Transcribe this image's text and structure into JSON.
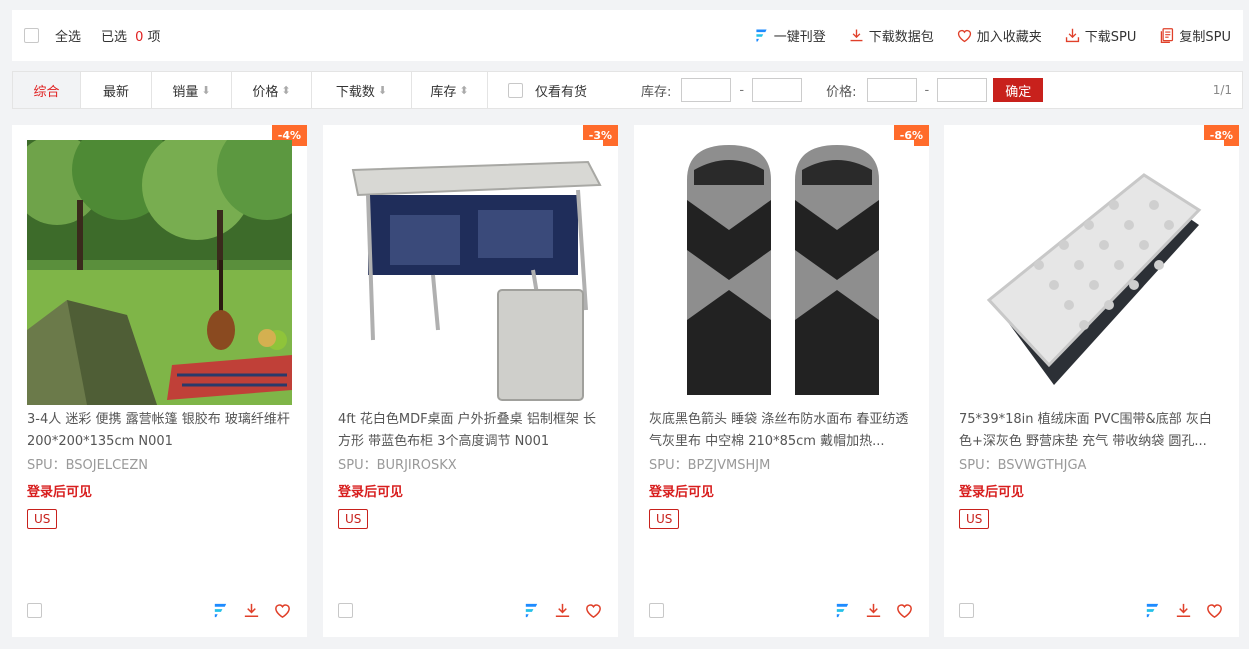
{
  "toolbar": {
    "select_all": "全选",
    "selected_prefix": "已选",
    "selected_count": "0",
    "selected_suffix": "项",
    "actions": {
      "publish": "一键刊登",
      "download_pack": "下载数据包",
      "favorite": "加入收藏夹",
      "download_spu": "下载SPU",
      "copy_spu": "复制SPU"
    }
  },
  "filters": {
    "sorts": {
      "overall": "综合",
      "newest": "最新",
      "sales": "销量",
      "price": "价格",
      "downloads": "下载数",
      "stock": "库存"
    },
    "only_in_stock": "仅看有货",
    "stock_label": "库存:",
    "price_label": "价格:",
    "confirm": "确定",
    "page": "1/1"
  },
  "products": [
    {
      "discount": "-4%",
      "title": "3-4人 迷彩 便携 露营帐篷 银胶布 玻璃纤维杆 200*200*135cm N001",
      "spu": "SPU：BSOJELCEZN",
      "price_note": "登录后可见",
      "region": "US"
    },
    {
      "discount": "-3%",
      "title": "4ft 花白色MDF桌面 户外折叠桌 铝制框架 长方形 带蓝色布柜 3个高度调节 N001",
      "spu": "SPU：BURJIROSKX",
      "price_note": "登录后可见",
      "region": "US"
    },
    {
      "discount": "-6%",
      "title": "灰底黑色箭头 睡袋 涤丝布防水面布 春亚纺透气灰里布 中空棉 210*85cm 戴帽加热...",
      "spu": "SPU：BPZJVMSHJM",
      "price_note": "登录后可见",
      "region": "US"
    },
    {
      "discount": "-8%",
      "title": "75*39*18in 植绒床面 PVC围带&底部 灰白色+深灰色 野营床垫 充气 带收纳袋 圆孔...",
      "spu": "SPU：BSVWGTHJGA",
      "price_note": "登录后可见",
      "region": "US"
    }
  ],
  "colors": {
    "accent_red": "#c8211c",
    "badge_orange": "#ff6b2b",
    "brand_blue": "#1e8bff"
  }
}
